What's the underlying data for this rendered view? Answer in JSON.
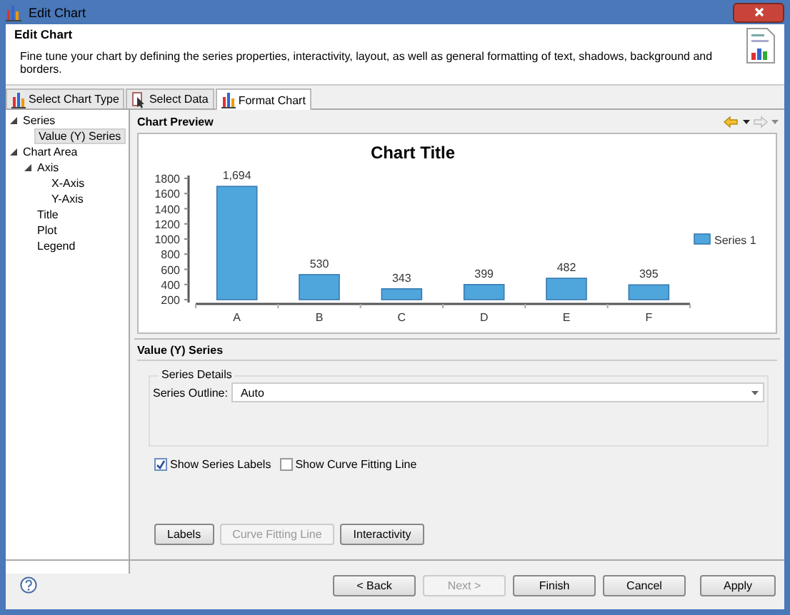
{
  "window": {
    "title": "Edit Chart"
  },
  "header": {
    "title": "Edit Chart",
    "description": "Fine tune your chart by defining the series properties, interactivity, layout, as well as general formatting of text, shadows, background and borders."
  },
  "tabs": [
    {
      "label": "Select Chart Type",
      "selected": false
    },
    {
      "label": "Select Data",
      "selected": false
    },
    {
      "label": "Format Chart",
      "selected": true
    }
  ],
  "tree": [
    {
      "label": "Series",
      "expanded": true,
      "selected": false,
      "children": [
        {
          "label": "Value (Y) Series",
          "selected": true
        }
      ]
    },
    {
      "label": "Chart Area",
      "expanded": true,
      "selected": false,
      "children": [
        {
          "label": "Axis",
          "expanded": true,
          "selected": false,
          "children": [
            {
              "label": "X-Axis",
              "selected": false
            },
            {
              "label": "Y-Axis",
              "selected": false
            }
          ]
        },
        {
          "label": "Title",
          "selected": false
        },
        {
          "label": "Plot",
          "selected": false
        },
        {
          "label": "Legend",
          "selected": false
        }
      ]
    }
  ],
  "preview": {
    "heading": "Chart Preview",
    "chart_data": {
      "type": "bar",
      "title": "Chart Title",
      "categories": [
        "A",
        "B",
        "C",
        "D",
        "E",
        "F"
      ],
      "series": [
        {
          "name": "Series 1",
          "color": "#4ea6dc",
          "values": [
            1694,
            530,
            343,
            399,
            482,
            395
          ]
        }
      ],
      "ylim": [
        200,
        1800
      ],
      "yticks": [
        200,
        400,
        600,
        800,
        1000,
        1200,
        1400,
        1600,
        1800
      ],
      "value_labels": [
        "1,694",
        "530",
        "343",
        "399",
        "482",
        "395"
      ]
    }
  },
  "series_panel": {
    "heading": "Value (Y) Series",
    "group_title": "Series Details",
    "outline_label": "Series Outline:",
    "outline_value": "Auto",
    "checkboxes": [
      {
        "label": "Show Series Labels",
        "checked": true
      },
      {
        "label": "Show Curve Fitting Line",
        "checked": false
      }
    ],
    "buttons": [
      {
        "label": "Labels",
        "disabled": false
      },
      {
        "label": "Curve Fitting Line",
        "disabled": true
      },
      {
        "label": "Interactivity",
        "disabled": false
      }
    ]
  },
  "footer_buttons": [
    {
      "label": "< Back",
      "disabled": false
    },
    {
      "label": "Next >",
      "disabled": true
    },
    {
      "label": "Finish",
      "disabled": false
    },
    {
      "label": "Cancel",
      "disabled": false
    },
    {
      "label": "Apply",
      "disabled": false
    }
  ]
}
